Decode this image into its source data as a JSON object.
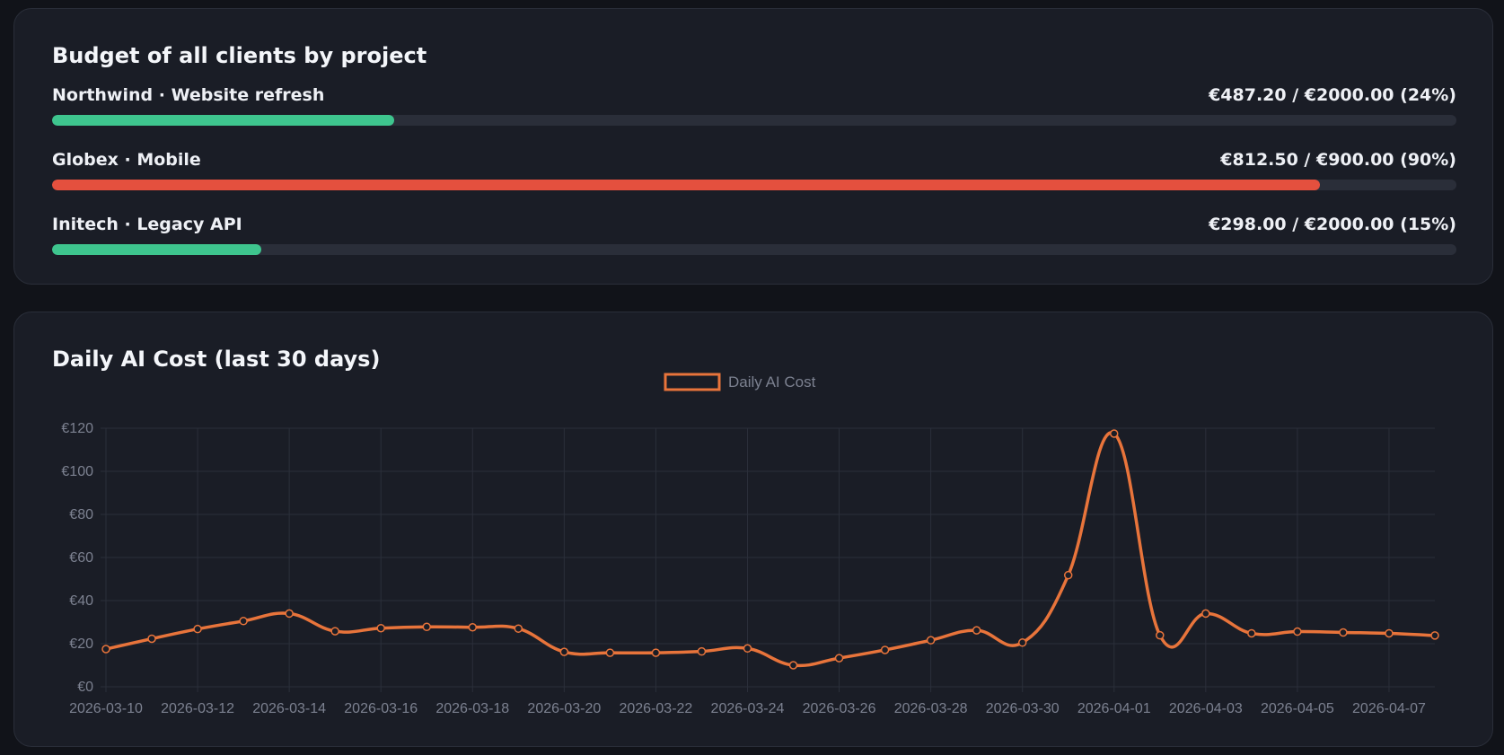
{
  "budget": {
    "title": "Budget of all clients by project",
    "colors": {
      "ok": "#3ec58e",
      "over": "#e4503e",
      "track": "#2a2e39"
    },
    "items": [
      {
        "label": "Northwind · Website refresh",
        "value_text": "€487.20 / €2000.00 (24%)",
        "fraction": 0.2436,
        "status": "ok"
      },
      {
        "label": "Globex · Mobile",
        "value_text": "€812.50 / €900.00 (90%)",
        "fraction": 0.9028,
        "status": "over"
      },
      {
        "label": "Initech · Legacy API",
        "value_text": "€298.00 / €2000.00 (15%)",
        "fraction": 0.149,
        "status": "ok"
      }
    ]
  },
  "chart_section": {
    "title": "Daily AI Cost (last 30 days)"
  },
  "chart_data": {
    "type": "line",
    "legend": {
      "position": "top-center",
      "entries": [
        "Daily AI Cost"
      ]
    },
    "grid": true,
    "line_color": "#e8743b",
    "ylim": [
      0,
      120
    ],
    "y_ticks": [
      0,
      20,
      40,
      60,
      80,
      100,
      120
    ],
    "y_tick_prefix": "€",
    "x": [
      "2026-03-10",
      "2026-03-11",
      "2026-03-12",
      "2026-03-13",
      "2026-03-14",
      "2026-03-15",
      "2026-03-16",
      "2026-03-17",
      "2026-03-18",
      "2026-03-19",
      "2026-03-20",
      "2026-03-21",
      "2026-03-22",
      "2026-03-23",
      "2026-03-24",
      "2026-03-25",
      "2026-03-26",
      "2026-03-27",
      "2026-03-28",
      "2026-03-29",
      "2026-03-30",
      "2026-03-31",
      "2026-04-01",
      "2026-04-02",
      "2026-04-03",
      "2026-04-04",
      "2026-04-05",
      "2026-04-06",
      "2026-04-07",
      "2026-04-08"
    ],
    "x_tick_labels": [
      "2026-03-10",
      "2026-03-12",
      "2026-03-14",
      "2026-03-16",
      "2026-03-18",
      "2026-03-20",
      "2026-03-22",
      "2026-03-24",
      "2026-03-26",
      "2026-03-28",
      "2026-03-30",
      "2026-04-01",
      "2026-04-03",
      "2026-04-05",
      "2026-04-07"
    ],
    "series": [
      {
        "name": "Daily AI Cost",
        "values": [
          17.5,
          22.3,
          26.8,
          30.5,
          34.0,
          25.8,
          27.2,
          27.8,
          27.6,
          27.0,
          16.2,
          15.8,
          15.8,
          16.4,
          17.8,
          10.0,
          13.3,
          17.1,
          21.6,
          26.2,
          20.5,
          51.8,
          117.5,
          23.9,
          34.0,
          24.8,
          25.6,
          25.2,
          24.8,
          23.8
        ]
      }
    ]
  }
}
